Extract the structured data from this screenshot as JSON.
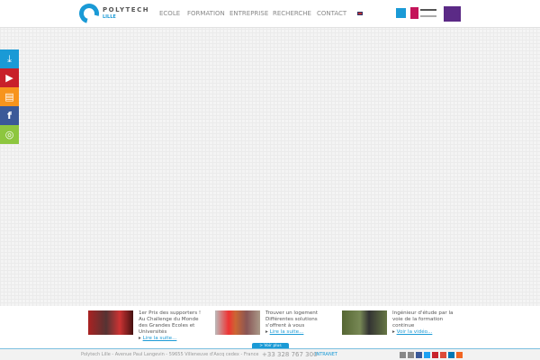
{
  "header": {
    "logo_name": "POLYTECH",
    "logo_sub": "LILLE",
    "nav": [
      "ECOLE",
      "FORMATION",
      "ENTREPRISE",
      "RECHERCHE",
      "CONTACT"
    ],
    "language": "en"
  },
  "side_icons": [
    {
      "name": "download",
      "color": "#1a9ad6",
      "glyph": "⤓"
    },
    {
      "name": "play",
      "color": "#c8202a",
      "glyph": "▶"
    },
    {
      "name": "document",
      "color": "#f7941d",
      "glyph": "▤"
    },
    {
      "name": "facebook",
      "color": "#3b5998",
      "glyph": "f"
    },
    {
      "name": "location",
      "color": "#8dc63f",
      "glyph": "◎"
    }
  ],
  "news": [
    {
      "title": "1er Prix des supporters ! Au Challenge du Monde des Grandes Ecoles et Universités",
      "link": "Lire la suite..."
    },
    {
      "title": "Trouver un logement Différentes solutions s'offrent à vous",
      "link": "Lire la suite..."
    },
    {
      "title": "Ingénieur d'étude par la voie de la formation continue",
      "link": "Voir la vidéo..."
    }
  ],
  "more_news": "> Voir plus d'actus",
  "footer": {
    "address": "Polytech Lille - Avenue Paul Langevin - 59655 Villeneuve d'Ascq cedex - France",
    "phone": "+33 328 767 300",
    "intranet": "INTRANET"
  },
  "social_colors": [
    "#888",
    "#888",
    "#3b5998",
    "#1da1f2",
    "#c8232c",
    "#dd4b39",
    "#0077b5",
    "#f26522"
  ]
}
